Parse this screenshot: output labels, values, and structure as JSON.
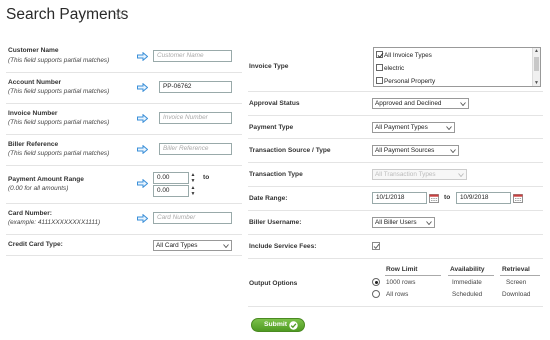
{
  "page": {
    "title": "Search Payments",
    "star_icon": "star-outline-icon"
  },
  "left": {
    "customer_name": {
      "label": "Customer Name",
      "hint": "(This field supports partial matches)",
      "value": "",
      "placeholder": "Customer Name"
    },
    "account_number": {
      "label": "Account Number",
      "hint": "(This field supports partial matches)",
      "value": "PP-06762",
      "placeholder": ""
    },
    "invoice_number": {
      "label": "Invoice Number",
      "hint": "(This field supports partial matches)",
      "value": "",
      "placeholder": "Invoice Number"
    },
    "biller_reference": {
      "label": "Biller Reference",
      "hint": "(This field supports partial matches)",
      "value": "",
      "placeholder": "Biller Reference"
    },
    "payment_amount_range": {
      "label": "Payment Amount Range",
      "hint": "(0.00 for all amounts)",
      "min": "0.00",
      "max": "0.00",
      "to_label": "to"
    },
    "card_number": {
      "label": "Card Number:",
      "hint": "(example: 4111XXXXXXXX1111)",
      "value": "",
      "placeholder": "Card Number"
    },
    "credit_card_type": {
      "label": "Credit Card Type:",
      "selected": "All Card Types"
    }
  },
  "right": {
    "invoice_type": {
      "label": "Invoice Type",
      "options": [
        {
          "label": "All Invoice Types",
          "checked": true
        },
        {
          "label": "electric",
          "checked": false
        },
        {
          "label": "Personal Property",
          "checked": false
        }
      ]
    },
    "approval_status": {
      "label": "Approval Status",
      "selected": "Approved and Declined"
    },
    "payment_type": {
      "label": "Payment Type",
      "selected": "All Payment Types"
    },
    "transaction_source": {
      "label": "Transaction Source / Type",
      "selected": "All Payment Sources"
    },
    "transaction_type": {
      "label": "Transaction Type",
      "selected": "All Transaction Types"
    },
    "date_range": {
      "label": "Date Range:",
      "from": "10/1/2018",
      "to": "10/9/2018",
      "to_label": "to"
    },
    "biller_username": {
      "label": "Biller Username:",
      "selected": "All Biller Users"
    },
    "include_service_fees": {
      "label": "Include Service Fees:",
      "checked": true
    },
    "output_options": {
      "label": "Output Options",
      "headers": {
        "row_limit": "Row Limit",
        "availability": "Availability",
        "retrieval": "Retrieval"
      },
      "rows": [
        {
          "row_limit": "1000 rows",
          "availability": "Immediate",
          "retrieval": "Screen",
          "selected": true
        },
        {
          "row_limit": "All rows",
          "availability": "Scheduled",
          "retrieval": "Download",
          "selected": false
        }
      ]
    }
  },
  "actions": {
    "submit_label": "Submit"
  },
  "colors": {
    "accent_blue": "#3a8fd8",
    "submit_green": "#5ba52c"
  }
}
